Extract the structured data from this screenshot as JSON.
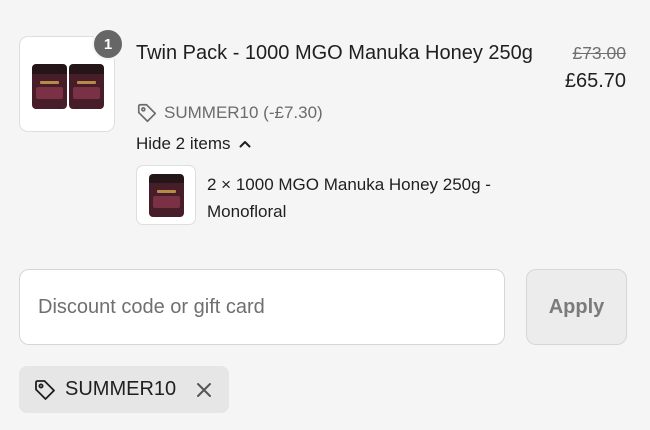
{
  "line_item": {
    "quantity": "1",
    "title": "Twin Pack - 1000 MGO Manuka Honey 250g",
    "original_price": "£73.00",
    "price": "£65.70",
    "discount_text": "SUMMER10 (-£7.30)",
    "toggle_label": "Hide 2 items",
    "bundle_item": {
      "title": "2 × 1000 MGO Manuka Honey 250g - Monofloral"
    }
  },
  "discount_form": {
    "placeholder": "Discount code or gift card",
    "value": "",
    "apply_label": "Apply"
  },
  "applied_codes": [
    {
      "code": "SUMMER10"
    }
  ],
  "icons": {
    "tag": "tag-icon",
    "chevron": "chevron-up-icon",
    "remove": "close-icon"
  },
  "colors": {
    "background": "#f5f5f5",
    "badge": "#666666",
    "chip": "#e6e6e6",
    "honey_jar": "#471d2a"
  }
}
